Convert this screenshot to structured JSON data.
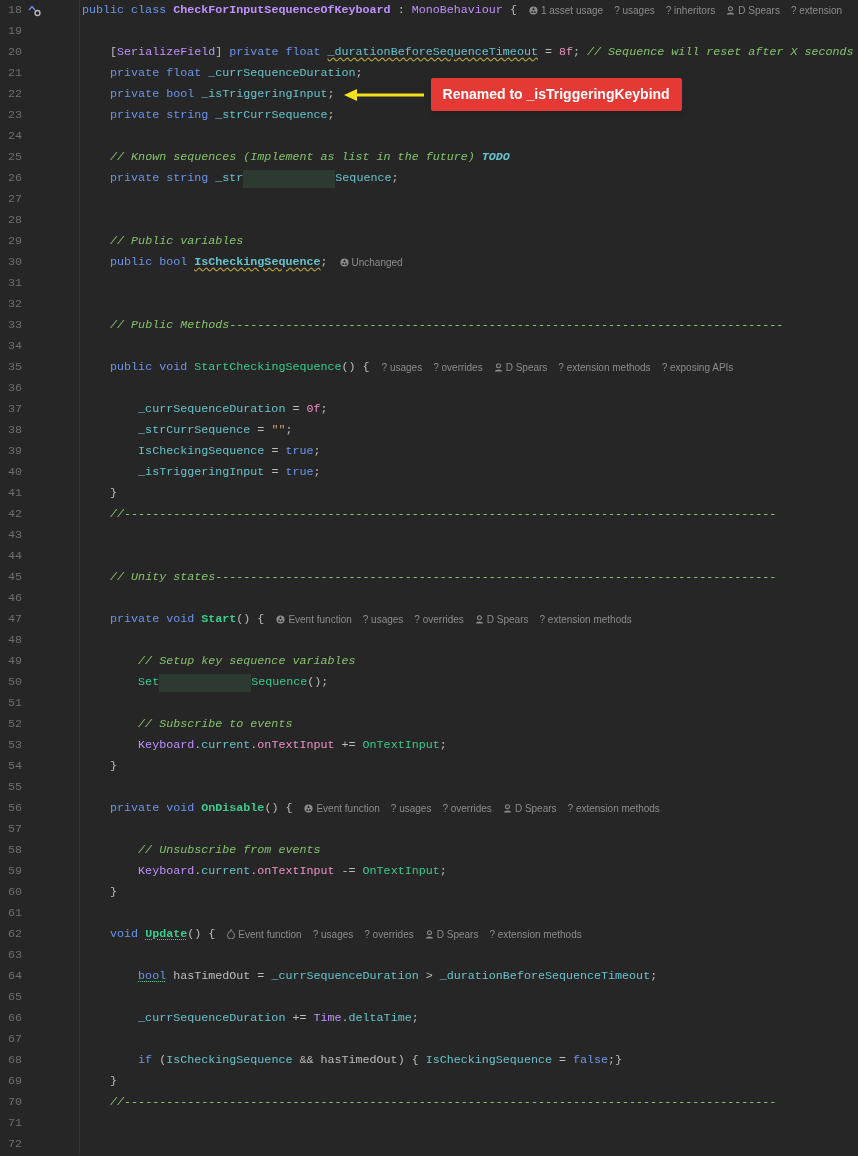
{
  "lines": [
    {
      "number": "18",
      "gutter_marker": true,
      "tokens": [
        {
          "text": "public class ",
          "kind": "kw"
        },
        {
          "text": "CheckForInputSequenceOfKeyboard",
          "kind": "cls",
          "bold": true
        },
        {
          "text": " : ",
          "kind": "plain"
        },
        {
          "text": "MonoBehaviour",
          "kind": "cls"
        },
        {
          "text": " {",
          "kind": "plain"
        }
      ],
      "hints": [
        {
          "kind": "unity",
          "text": "1 asset usage"
        },
        {
          "text": "? usages"
        },
        {
          "text": "? inheritors"
        },
        {
          "kind": "person",
          "text": "D Spears"
        },
        {
          "text": "? extension"
        }
      ]
    },
    {
      "number": "19"
    },
    {
      "number": "20",
      "tokens": [
        {
          "text": "    [",
          "kind": "plain"
        },
        {
          "text": "SerializeField",
          "kind": "attr"
        },
        {
          "text": "] ",
          "kind": "plain"
        },
        {
          "text": "private float ",
          "kind": "kw"
        },
        {
          "text": "_durationBeforeSequenceTimeout",
          "kind": "field",
          "warning": true
        },
        {
          "text": " = ",
          "kind": "plain"
        },
        {
          "text": "8f",
          "kind": "num"
        },
        {
          "text": "; ",
          "kind": "plain"
        },
        {
          "text": "// Sequence will reset after X seconds",
          "kind": "cmt"
        }
      ]
    },
    {
      "number": "21",
      "tokens": [
        {
          "text": "    private float ",
          "kind": "kw"
        },
        {
          "text": "_currSequenceDuration",
          "kind": "field"
        },
        {
          "text": ";",
          "kind": "plain"
        }
      ]
    },
    {
      "number": "22",
      "tokens": [
        {
          "text": "    private bool ",
          "kind": "kw"
        },
        {
          "text": "_isTriggeringInput",
          "kind": "field"
        },
        {
          "text": ";",
          "kind": "plain"
        }
      ],
      "callout": "Renamed to _isTriggeringKeybind"
    },
    {
      "number": "23",
      "tokens": [
        {
          "text": "    private string ",
          "kind": "kw"
        },
        {
          "text": "_strCurrSequence",
          "kind": "field"
        },
        {
          "text": ";",
          "kind": "plain"
        }
      ]
    },
    {
      "number": "24"
    },
    {
      "number": "25",
      "tokens": [
        {
          "text": "    // Known sequences (Implement as list in the future) ",
          "kind": "cmt"
        },
        {
          "text": "TODO",
          "kind": "todo"
        }
      ]
    },
    {
      "number": "26",
      "tokens": [
        {
          "text": "    private string ",
          "kind": "kw"
        },
        {
          "text": "_str",
          "kind": "field"
        },
        {
          "kind": "redacted"
        },
        {
          "text": "Sequence",
          "kind": "field"
        },
        {
          "text": ";",
          "kind": "plain"
        }
      ]
    },
    {
      "number": "27"
    },
    {
      "number": "28"
    },
    {
      "number": "29",
      "tokens": [
        {
          "text": "    // Public variables",
          "kind": "cmt"
        }
      ]
    },
    {
      "number": "30",
      "tokens": [
        {
          "text": "    public bool ",
          "kind": "kw"
        },
        {
          "text": "IsCheckingSequence",
          "kind": "field",
          "bold": true,
          "warning": true
        },
        {
          "text": ";",
          "kind": "plain"
        }
      ],
      "hints": [
        {
          "kind": "unity",
          "text": "Unchanged"
        }
      ]
    },
    {
      "number": "31"
    },
    {
      "number": "32"
    },
    {
      "number": "33",
      "tokens": [
        {
          "text": "    // Public Methods-------------------------------------------------------------------------------",
          "kind": "cmt"
        }
      ]
    },
    {
      "number": "34"
    },
    {
      "number": "35",
      "tokens": [
        {
          "text": "    public void ",
          "kind": "kw"
        },
        {
          "text": "StartCheckingSequence",
          "kind": "method"
        },
        {
          "text": "() {",
          "kind": "plain"
        }
      ],
      "hints": [
        {
          "text": "? usages"
        },
        {
          "text": "? overrides"
        },
        {
          "kind": "person",
          "text": "D Spears"
        },
        {
          "text": "? extension methods"
        },
        {
          "text": "? exposing APIs"
        }
      ]
    },
    {
      "number": "36"
    },
    {
      "number": "37",
      "tokens": [
        {
          "text": "        _currSequenceDuration",
          "kind": "field"
        },
        {
          "text": " = ",
          "kind": "plain"
        },
        {
          "text": "0f",
          "kind": "num"
        },
        {
          "text": ";",
          "kind": "plain"
        }
      ]
    },
    {
      "number": "38",
      "tokens": [
        {
          "text": "        _strCurrSequence",
          "kind": "field"
        },
        {
          "text": " = ",
          "kind": "plain"
        },
        {
          "text": "\"\"",
          "kind": "str"
        },
        {
          "text": ";",
          "kind": "plain"
        }
      ]
    },
    {
      "number": "39",
      "tokens": [
        {
          "text": "        IsCheckingSequence",
          "kind": "field"
        },
        {
          "text": " = ",
          "kind": "plain"
        },
        {
          "text": "true",
          "kind": "kw"
        },
        {
          "text": ";",
          "kind": "plain"
        }
      ]
    },
    {
      "number": "40",
      "tokens": [
        {
          "text": "        _isTriggeringInput",
          "kind": "field"
        },
        {
          "text": " = ",
          "kind": "plain"
        },
        {
          "text": "true",
          "kind": "kw"
        },
        {
          "text": ";",
          "kind": "plain"
        }
      ]
    },
    {
      "number": "41",
      "tokens": [
        {
          "text": "    }",
          "kind": "plain"
        }
      ]
    },
    {
      "number": "42",
      "tokens": [
        {
          "text": "    //---------------------------------------------------------------------------------------------",
          "kind": "cmt"
        }
      ]
    },
    {
      "number": "43"
    },
    {
      "number": "44"
    },
    {
      "number": "45",
      "tokens": [
        {
          "text": "    // Unity states--------------------------------------------------------------------------------",
          "kind": "cmt"
        }
      ]
    },
    {
      "number": "46"
    },
    {
      "number": "47",
      "tokens": [
        {
          "text": "    private void ",
          "kind": "kw"
        },
        {
          "text": "Start",
          "kind": "method",
          "bold": true
        },
        {
          "text": "() {",
          "kind": "plain"
        }
      ],
      "hints": [
        {
          "kind": "unity",
          "text": "Event function"
        },
        {
          "text": "? usages"
        },
        {
          "text": "? overrides"
        },
        {
          "kind": "person",
          "text": "D Spears"
        },
        {
          "text": "? extension methods"
        }
      ]
    },
    {
      "number": "48"
    },
    {
      "number": "49",
      "tokens": [
        {
          "text": "        // Setup key sequence variables",
          "kind": "cmt"
        }
      ]
    },
    {
      "number": "50",
      "tokens": [
        {
          "text": "        Set",
          "kind": "method"
        },
        {
          "kind": "redacted"
        },
        {
          "text": "Sequence",
          "kind": "method"
        },
        {
          "text": "();",
          "kind": "plain"
        }
      ]
    },
    {
      "number": "51"
    },
    {
      "number": "52",
      "tokens": [
        {
          "text": "        // Subscribe to events",
          "kind": "cmt"
        }
      ]
    },
    {
      "number": "53",
      "tokens": [
        {
          "text": "        Keyboard",
          "kind": "cls"
        },
        {
          "text": ".",
          "kind": "plain"
        },
        {
          "text": "current",
          "kind": "field"
        },
        {
          "text": ".",
          "kind": "plain"
        },
        {
          "text": "onTextInput",
          "kind": "event"
        },
        {
          "text": " += ",
          "kind": "plain"
        },
        {
          "text": "OnTextInput",
          "kind": "method"
        },
        {
          "text": ";",
          "kind": "plain"
        }
      ]
    },
    {
      "number": "54",
      "tokens": [
        {
          "text": "    }",
          "kind": "plain"
        }
      ]
    },
    {
      "number": "55"
    },
    {
      "number": "56",
      "tokens": [
        {
          "text": "    private void ",
          "kind": "kw"
        },
        {
          "text": "OnDisable",
          "kind": "method",
          "bold": true
        },
        {
          "text": "() {",
          "kind": "plain"
        }
      ],
      "hints": [
        {
          "kind": "unity",
          "text": "Event function"
        },
        {
          "text": "? usages"
        },
        {
          "text": "? overrides"
        },
        {
          "kind": "person",
          "text": "D Spears"
        },
        {
          "text": "? extension methods"
        }
      ]
    },
    {
      "number": "57"
    },
    {
      "number": "58",
      "tokens": [
        {
          "text": "        // Unsubscribe from events",
          "kind": "cmt"
        }
      ]
    },
    {
      "number": "59",
      "tokens": [
        {
          "text": "        Keyboard",
          "kind": "cls"
        },
        {
          "text": ".",
          "kind": "plain"
        },
        {
          "text": "current",
          "kind": "field"
        },
        {
          "text": ".",
          "kind": "plain"
        },
        {
          "text": "onTextInput",
          "kind": "event"
        },
        {
          "text": " -= ",
          "kind": "plain"
        },
        {
          "text": "OnTextInput",
          "kind": "method"
        },
        {
          "text": ";",
          "kind": "plain"
        }
      ]
    },
    {
      "number": "60",
      "tokens": [
        {
          "text": "    }",
          "kind": "plain"
        }
      ]
    },
    {
      "number": "61"
    },
    {
      "number": "62",
      "tokens": [
        {
          "text": "    void ",
          "kind": "kw"
        },
        {
          "text": "Update",
          "kind": "method",
          "bold": true,
          "suggestion": true
        },
        {
          "text": "() {",
          "kind": "plain"
        }
      ],
      "hints": [
        {
          "kind": "flame",
          "text": "Event function"
        },
        {
          "text": "? usages"
        },
        {
          "text": "? overrides"
        },
        {
          "kind": "person",
          "text": "D Spears"
        },
        {
          "text": "? extension methods"
        }
      ]
    },
    {
      "number": "63"
    },
    {
      "number": "64",
      "tokens": [
        {
          "text": "        bool",
          "kind": "kw",
          "suggestion": true
        },
        {
          "text": " hasTimedOut = ",
          "kind": "plain"
        },
        {
          "text": "_currSequenceDuration",
          "kind": "field"
        },
        {
          "text": " > ",
          "kind": "plain"
        },
        {
          "text": "_durationBeforeSequenceTimeout",
          "kind": "field"
        },
        {
          "text": ";",
          "kind": "plain"
        }
      ]
    },
    {
      "number": "65"
    },
    {
      "number": "66",
      "tokens": [
        {
          "text": "        _currSequenceDuration",
          "kind": "field"
        },
        {
          "text": " += ",
          "kind": "plain"
        },
        {
          "text": "Time",
          "kind": "cls"
        },
        {
          "text": ".",
          "kind": "plain"
        },
        {
          "text": "deltaTime",
          "kind": "field"
        },
        {
          "text": ";",
          "kind": "plain"
        }
      ]
    },
    {
      "number": "67"
    },
    {
      "number": "68",
      "tokens": [
        {
          "text": "        if ",
          "kind": "kw"
        },
        {
          "text": "(",
          "kind": "plain"
        },
        {
          "text": "IsCheckingSequence",
          "kind": "field"
        },
        {
          "text": " && hasTimedOut) { ",
          "kind": "plain"
        },
        {
          "text": "IsCheckingSequence",
          "kind": "field"
        },
        {
          "text": " = ",
          "kind": "plain"
        },
        {
          "text": "false",
          "kind": "kw"
        },
        {
          "text": ";}",
          "kind": "plain"
        }
      ]
    },
    {
      "number": "69",
      "tokens": [
        {
          "text": "    }",
          "kind": "plain"
        }
      ]
    },
    {
      "number": "70",
      "tokens": [
        {
          "text": "    //---------------------------------------------------------------------------------------------",
          "kind": "cmt"
        }
      ]
    },
    {
      "number": "71"
    },
    {
      "number": "72"
    }
  ]
}
